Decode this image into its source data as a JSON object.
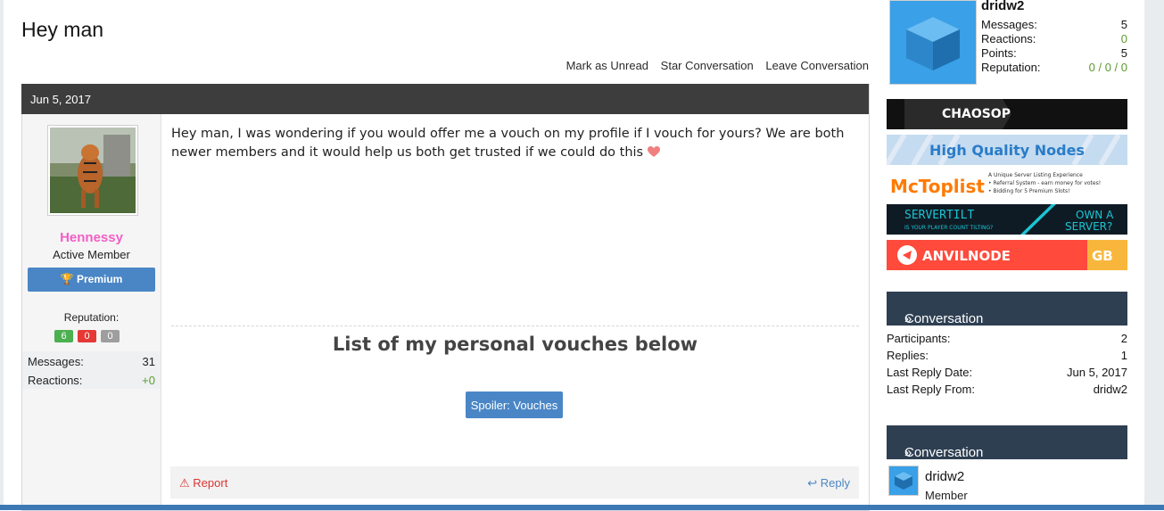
{
  "title": "Hey man",
  "conversation_links": [
    "Mark as Unread",
    "Star Conversation",
    "Leave Conversation"
  ],
  "message": {
    "date": "Jun 5, 2017",
    "author": {
      "name": "Hennessy",
      "title": "Active Member",
      "badge": "Premium",
      "reputation_label": "Reputation:",
      "reputation": [
        {
          "value": "6",
          "color": "#4caf50"
        },
        {
          "value": "0",
          "color": "#e53935"
        },
        {
          "value": "0",
          "color": "#9e9e9e"
        }
      ],
      "stats": [
        {
          "label": "Messages:",
          "value": "31"
        },
        {
          "label": "Reactions:",
          "value": "+0"
        }
      ]
    },
    "body": "Hey man, I was wondering if you would offer me a vouch on my profile if I vouch for yours? We are both newer members and it would help us both get trusted if we could do this",
    "vouch_heading": "List of my personal vouches below",
    "spoiler_label": "Spoiler: Vouches",
    "report_label": "Report",
    "reply_label": "Reply"
  },
  "sidebar": {
    "user": {
      "name": "dridw2",
      "stats": [
        {
          "label": "Messages:",
          "value": "5"
        },
        {
          "label": "Reactions:",
          "value": "0"
        },
        {
          "label": "Points:",
          "value": "5"
        },
        {
          "label": "Reputation:",
          "value": "0 / 0 / 0"
        }
      ]
    },
    "banners": [
      "CHAOSOP",
      "High Quality Nodes",
      "McToplist",
      "SERVERTILT",
      "ANVILNODE"
    ],
    "banner_text": {
      "mctoplist_lines": [
        "A Unique Server Listing Experience",
        "• Referral System - earn money for votes!",
        "• Bidding for 5 Premium Slots!"
      ],
      "servertilt_sub": "IS YOUR PLAYER COUNT TILTING?",
      "servertilt_cta_1": "OWN A",
      "servertilt_cta_2": "SERVER?",
      "anvil_suffix": "GB"
    },
    "conversation_info": {
      "heading": "Conversation Info",
      "rows": [
        {
          "label": "Participants:",
          "value": "2"
        },
        {
          "label": "Replies:",
          "value": "1"
        },
        {
          "label": "Last Reply Date:",
          "value": "Jun 5, 2017"
        },
        {
          "label": "Last Reply From:",
          "value": "dridw2"
        }
      ]
    },
    "participants": {
      "heading": "Conversation Participants",
      "items": [
        {
          "name": "dridw2",
          "role": "Member"
        }
      ]
    }
  }
}
